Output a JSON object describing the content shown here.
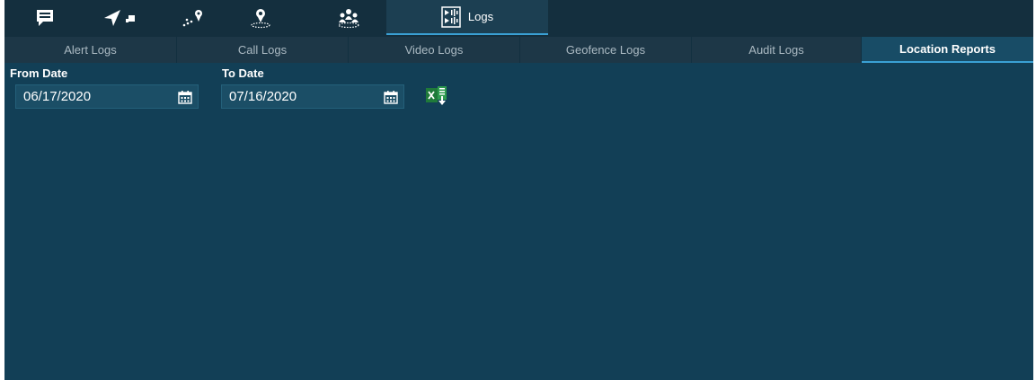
{
  "toolbar": {
    "items": [
      {
        "icon": "message-icon"
      },
      {
        "icon": "navigation-arrow-icon"
      },
      {
        "icon": "route-icon"
      },
      {
        "icon": "location-pin-icon"
      },
      {
        "icon": "group-icon"
      },
      {
        "icon": "logs-icon",
        "label": "Logs",
        "active": true
      }
    ]
  },
  "subtabs": [
    {
      "label": "Alert Logs"
    },
    {
      "label": "Call Logs"
    },
    {
      "label": "Video Logs"
    },
    {
      "label": "Geofence Logs"
    },
    {
      "label": "Audit Logs"
    },
    {
      "label": "Location Reports",
      "active": true
    }
  ],
  "form": {
    "from_label": "From Date",
    "from_value": "06/17/2020",
    "to_label": "To Date",
    "to_value": "07/16/2020",
    "export_icon": "excel-export-icon"
  },
  "colors": {
    "background": "#123f56",
    "toolbar": "#142f3e",
    "accent": "#3aa0d4",
    "excel_green": "#1f7a3a"
  }
}
